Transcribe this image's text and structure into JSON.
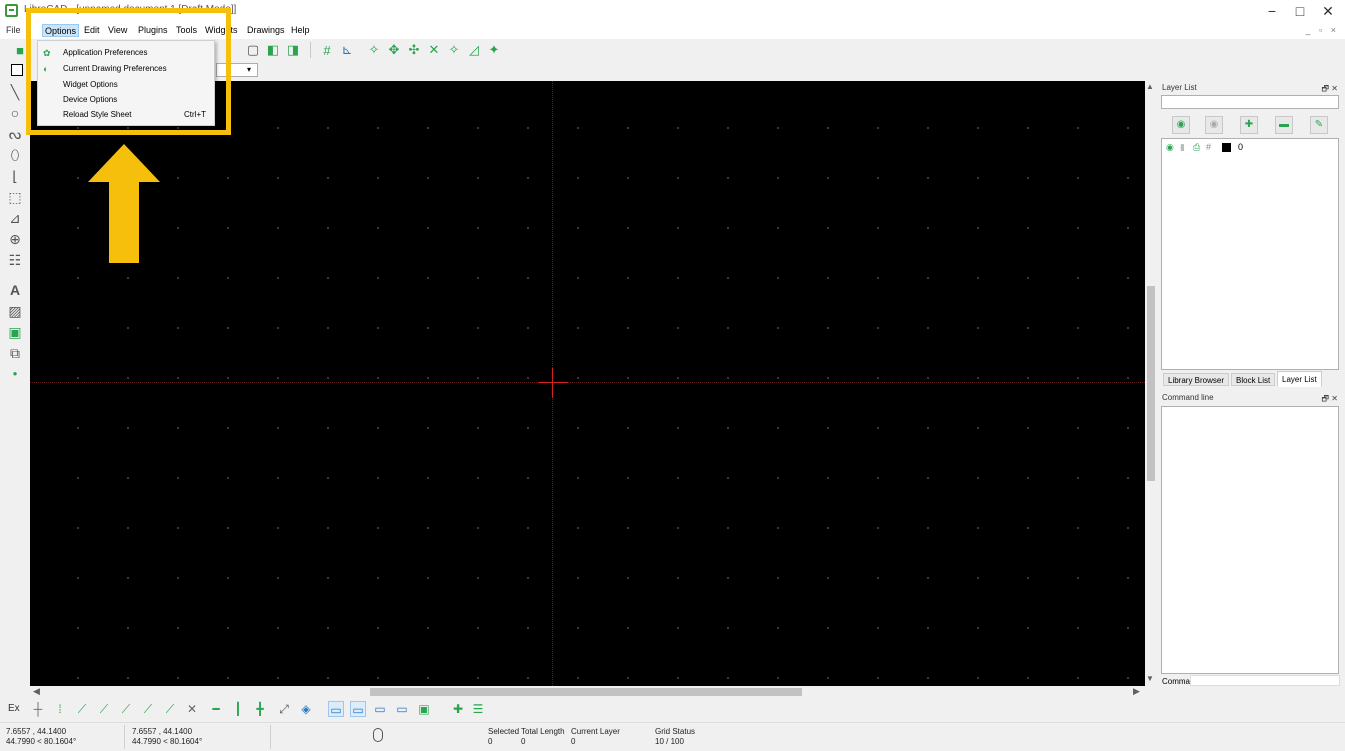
{
  "window": {
    "title": "LibreCAD - [unnamed document 1 [Draft Mode]]",
    "minimize": "−",
    "maximize": "□",
    "close": "✕"
  },
  "menubar": {
    "file_glyph": "File",
    "items": [
      "Options",
      "Edit",
      "View",
      "Plugins",
      "Tools",
      "Widgets",
      "Drawings",
      "Help"
    ],
    "active": "Options",
    "mdi_controls": "_ ▫ ×"
  },
  "options_menu": {
    "items": [
      {
        "label": "Application Preferences",
        "icon": "gear-icon",
        "shortcut": ""
      },
      {
        "label": "Current Drawing Preferences",
        "icon": "drawing-prefs-icon",
        "shortcut": ""
      },
      {
        "label": "Widget Options",
        "icon": "",
        "shortcut": ""
      },
      {
        "label": "Device Options",
        "icon": "",
        "shortcut": ""
      },
      {
        "label": "Reload Style Sheet",
        "icon": "",
        "shortcut": "Ctrl+T"
      }
    ]
  },
  "dock": {
    "layer_list_title": "Layer List",
    "dock_controls": "🗗 ✕",
    "layer": {
      "name": "0"
    },
    "tabs": [
      "Library Browser",
      "Block List",
      "Layer List"
    ],
    "active_tab": "Layer List",
    "command_title": "Command line",
    "command_label": "Command:"
  },
  "snapbar": {
    "ex_label": "Ex"
  },
  "status": {
    "abs_coord": "7.6557 , 44.1400",
    "abs_polar": "44.7990 < 80.1604°",
    "rel_coord": "7.6557 , 44.1400",
    "rel_polar": "44.7990 < 80.1604°",
    "selected_label": "Selected",
    "selected_value": "0",
    "total_length_label": "Total Length",
    "total_length_value": "0",
    "current_layer_label": "Current Layer",
    "current_layer_value": "0",
    "grid_status_label": "Grid Status",
    "grid_status_value": "10 / 100"
  },
  "colors": {
    "highlight": "#f5bf0b",
    "accent_green": "#2aa44f",
    "crosshair": "#d02020",
    "canvas": "#000000"
  }
}
